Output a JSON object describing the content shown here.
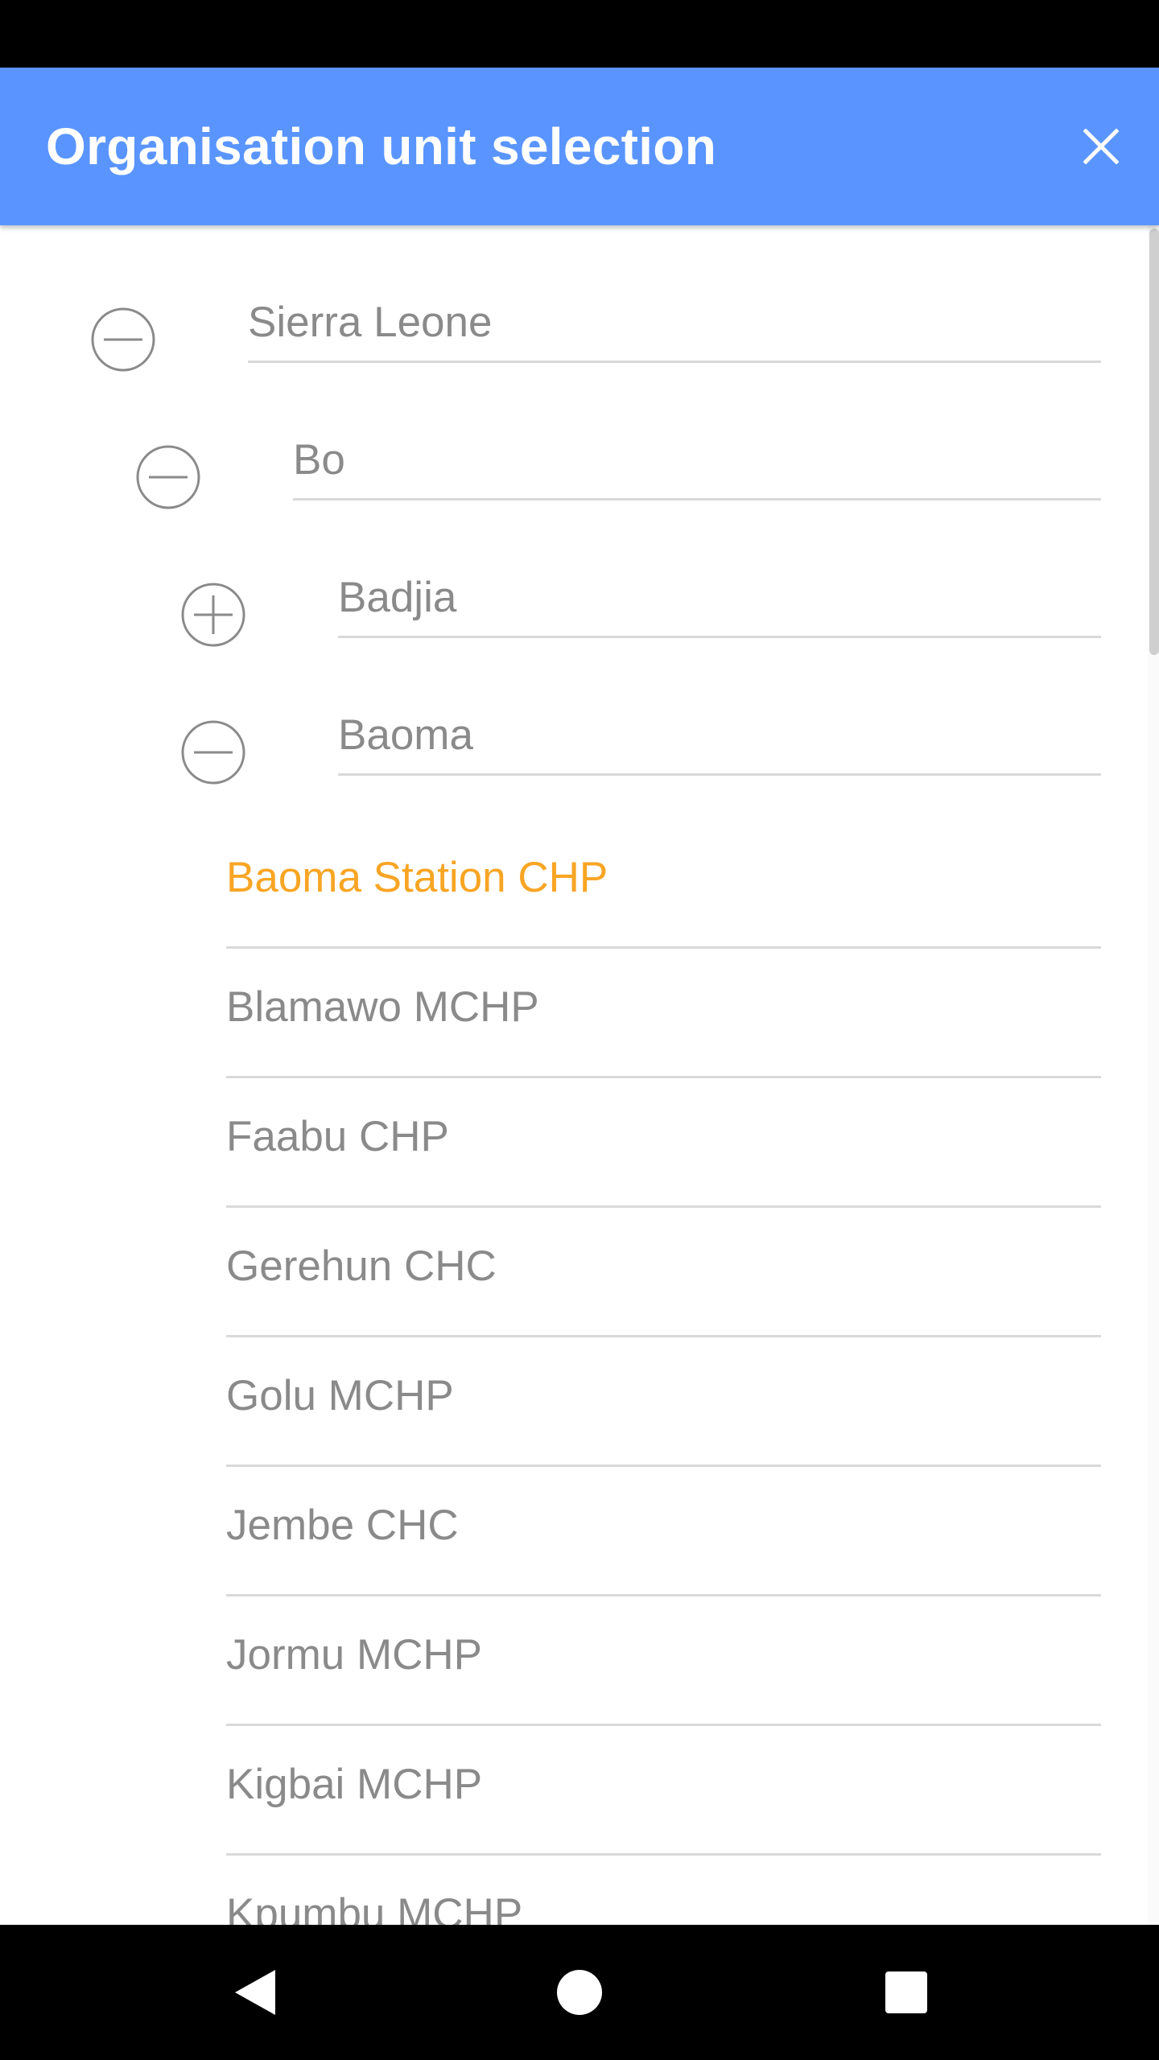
{
  "dialog": {
    "title": "Organisation unit selection"
  },
  "tree": {
    "nodes": [
      {
        "label": "Sierra Leone",
        "state": "expanded"
      },
      {
        "label": "Bo",
        "state": "expanded"
      },
      {
        "label": "Badjia",
        "state": "collapsed"
      },
      {
        "label": "Baoma",
        "state": "expanded"
      }
    ],
    "leaves": [
      {
        "label": "Baoma Station CHP",
        "selected": true
      },
      {
        "label": "Blamawo MCHP",
        "selected": false
      },
      {
        "label": "Faabu CHP",
        "selected": false
      },
      {
        "label": "Gerehun CHC",
        "selected": false
      },
      {
        "label": "Golu MCHP",
        "selected": false
      },
      {
        "label": "Jembe CHC",
        "selected": false
      },
      {
        "label": "Jormu MCHP",
        "selected": false
      },
      {
        "label": "Kigbai MCHP",
        "selected": false
      },
      {
        "label": "Kpumbu MCHP",
        "selected": false
      }
    ]
  },
  "colors": {
    "header": "#5a95ff",
    "selected_text": "#f8a524",
    "item_text": "#8a8a8a",
    "divider": "#d9d9d9"
  },
  "icons": {
    "expanded": "minus-circle-icon",
    "collapsed": "plus-circle-icon",
    "close": "close-icon",
    "nav_back": "back-triangle-icon",
    "nav_home": "home-circle-icon",
    "nav_recents": "recents-square-icon"
  }
}
